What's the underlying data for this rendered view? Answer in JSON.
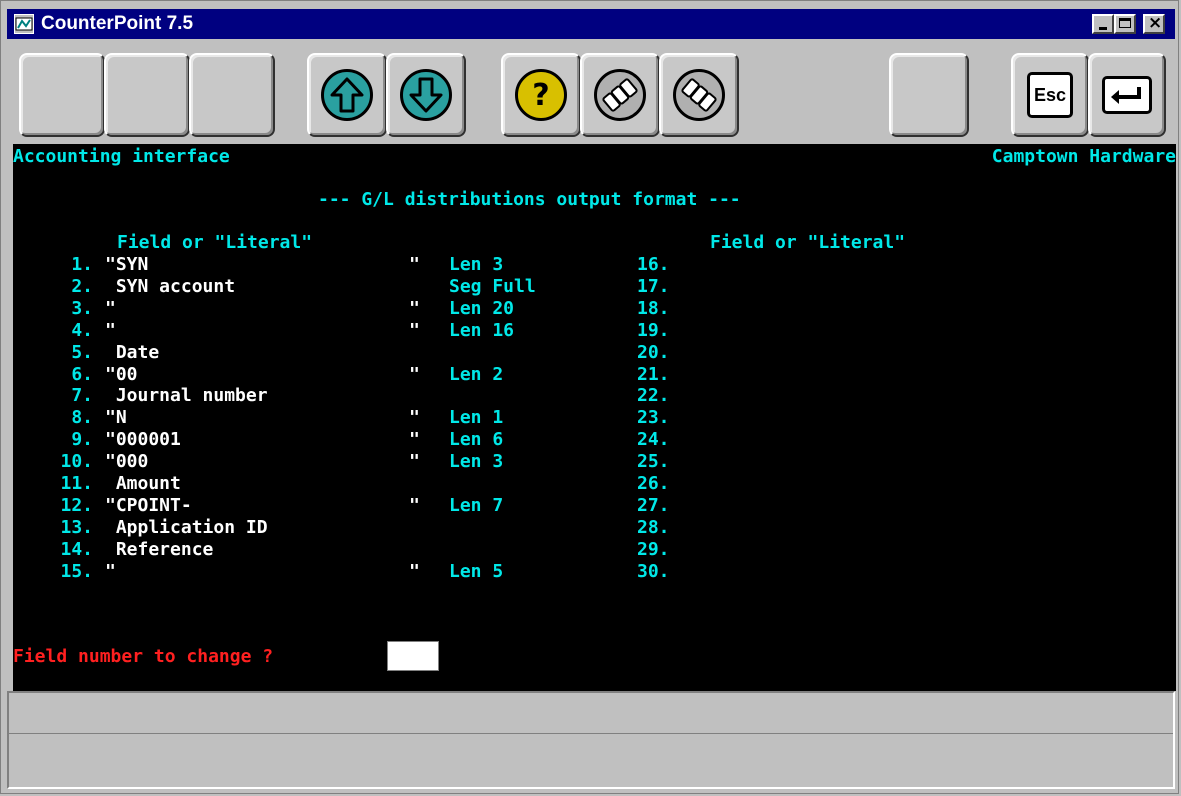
{
  "window": {
    "title": "CounterPoint 7.5"
  },
  "toolbar": {
    "colors": {
      "arrow": "#2aa0a0",
      "help": "#d8c000"
    },
    "buttons": [
      {
        "name": "blank-1",
        "icon": ""
      },
      {
        "name": "blank-2",
        "icon": ""
      },
      {
        "name": "blank-3",
        "icon": ""
      },
      {
        "name": "up",
        "icon": "up-arrow-icon"
      },
      {
        "name": "down",
        "icon": "down-arrow-icon"
      },
      {
        "name": "help",
        "icon": "question-mark-icon",
        "label": "?"
      },
      {
        "name": "numpad-1",
        "icon": "numeric-keypad-icon"
      },
      {
        "name": "numpad-2",
        "icon": "numeric-keypad-icon"
      },
      {
        "name": "blank-4",
        "icon": ""
      },
      {
        "name": "esc",
        "icon": "esc-key-icon",
        "label": "Esc"
      },
      {
        "name": "enter",
        "icon": "enter-key-icon"
      }
    ]
  },
  "screen": {
    "module": "Accounting interface",
    "company": "Camptown Hardware",
    "heading": "--- G/L distributions output format ---",
    "col_header_left": "Field or \"Literal\"",
    "col_header_right": "Field or \"Literal\"",
    "rows_left": [
      {
        "num": "1.",
        "field": "\"SYN",
        "quote": "\"",
        "spec": "Len 3"
      },
      {
        "num": "2.",
        "field": " SYN account",
        "quote": "",
        "spec": "Seg Full"
      },
      {
        "num": "3.",
        "field": "\"",
        "quote": "\"",
        "spec": "Len 20"
      },
      {
        "num": "4.",
        "field": "\"",
        "quote": "\"",
        "spec": "Len 16"
      },
      {
        "num": "5.",
        "field": " Date",
        "quote": "",
        "spec": ""
      },
      {
        "num": "6.",
        "field": "\"00",
        "quote": "\"",
        "spec": "Len 2"
      },
      {
        "num": "7.",
        "field": " Journal number",
        "quote": "",
        "spec": ""
      },
      {
        "num": "8.",
        "field": "\"N",
        "quote": "\"",
        "spec": "Len 1"
      },
      {
        "num": "9.",
        "field": "\"000001",
        "quote": "\"",
        "spec": "Len 6"
      },
      {
        "num": "10.",
        "field": "\"000",
        "quote": "\"",
        "spec": "Len 3"
      },
      {
        "num": "11.",
        "field": " Amount",
        "quote": "",
        "spec": ""
      },
      {
        "num": "12.",
        "field": "\"CPOINT-",
        "quote": "\"",
        "spec": "Len 7"
      },
      {
        "num": "13.",
        "field": " Application ID",
        "quote": "",
        "spec": ""
      },
      {
        "num": "14.",
        "field": " Reference",
        "quote": "",
        "spec": ""
      },
      {
        "num": "15.",
        "field": "\"",
        "quote": "\"",
        "spec": "Len 5"
      }
    ],
    "rows_right": [
      "16.",
      "17.",
      "18.",
      "19.",
      "20.",
      "21.",
      "22.",
      "23.",
      "24.",
      "25.",
      "26.",
      "27.",
      "28.",
      "29.",
      "30."
    ],
    "prompt": "Field number to change ?",
    "answer": ""
  }
}
